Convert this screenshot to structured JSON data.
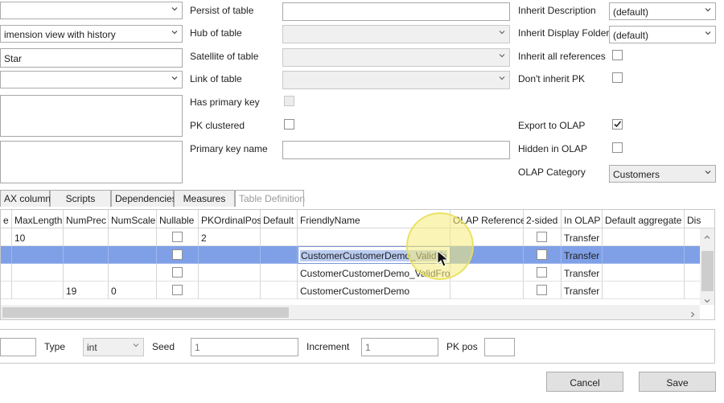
{
  "left": {
    "combo1_value": "",
    "combo2_value": "imension view with history",
    "field3_value": "Star",
    "combo4_value": ""
  },
  "middle": {
    "persist_label": "Persist of table",
    "hub_label": "Hub of table",
    "satellite_label": "Satellite of table",
    "link_label": "Link of table",
    "has_pk_label": "Has primary key",
    "pk_clustered_label": "PK clustered",
    "pk_name_label": "Primary key name"
  },
  "right": {
    "inherit_desc_label": "Inherit Description",
    "inherit_desc_value": "(default)",
    "inherit_folder_label": "Inherit Display Folder",
    "inherit_folder_value": "(default)",
    "inherit_refs_label": "Inherit all references",
    "dont_inherit_pk_label": "Don't inherit PK",
    "export_olap_label": "Export to OLAP",
    "export_olap_checked": true,
    "hidden_olap_label": "Hidden in OLAP",
    "olap_category_label": "OLAP Category",
    "olap_category_value": "Customers"
  },
  "tabs": [
    {
      "label": "AX columns"
    },
    {
      "label": "Scripts"
    },
    {
      "label": "Dependencies"
    },
    {
      "label": "Measures"
    },
    {
      "label": "Table Definition"
    }
  ],
  "grid": {
    "headers": [
      "e",
      "MaxLength",
      "NumPrec",
      "NumScale",
      "Nullable",
      "PKOrdinalPos",
      "Default",
      "FriendlyName",
      "OLAP Reference",
      "2-sided",
      "In OLAP",
      "Default aggregate",
      "Dis"
    ],
    "rows": [
      {
        "maxlength": "10",
        "numprec": "",
        "numscale": "",
        "pkpos": "2",
        "default": "",
        "friendly": "",
        "olapref": "",
        "inolap": "Transfer",
        "aggregate": ""
      },
      {
        "maxlength": "",
        "numprec": "",
        "numscale": "",
        "pkpos": "",
        "default": "",
        "friendly": "CustomerCustomerDemo_ValidTo",
        "olapref": "",
        "inolap": "Transfer",
        "aggregate": ""
      },
      {
        "maxlength": "",
        "numprec": "",
        "numscale": "",
        "pkpos": "",
        "default": "",
        "friendly": "CustomerCustomerDemo_ValidFrom",
        "olapref": "",
        "inolap": "Transfer",
        "aggregate": ""
      },
      {
        "maxlength": "",
        "numprec": "19",
        "numscale": "0",
        "pkpos": "",
        "default": "",
        "friendly": "CustomerCustomerDemo",
        "olapref": "",
        "inolap": "Transfer",
        "aggregate": ""
      }
    ]
  },
  "identity": {
    "type_label": "Type",
    "type_value": "int",
    "seed_label": "Seed",
    "seed_value": "1",
    "increment_label": "Increment",
    "increment_value": "1",
    "pkpos_label": "PK pos",
    "pkpos_value": ""
  },
  "buttons": {
    "cancel": "Cancel",
    "save": "Save"
  },
  "colors": {
    "selection": "#7fa0e6",
    "cursor_highlight": "#f5ec7a"
  }
}
